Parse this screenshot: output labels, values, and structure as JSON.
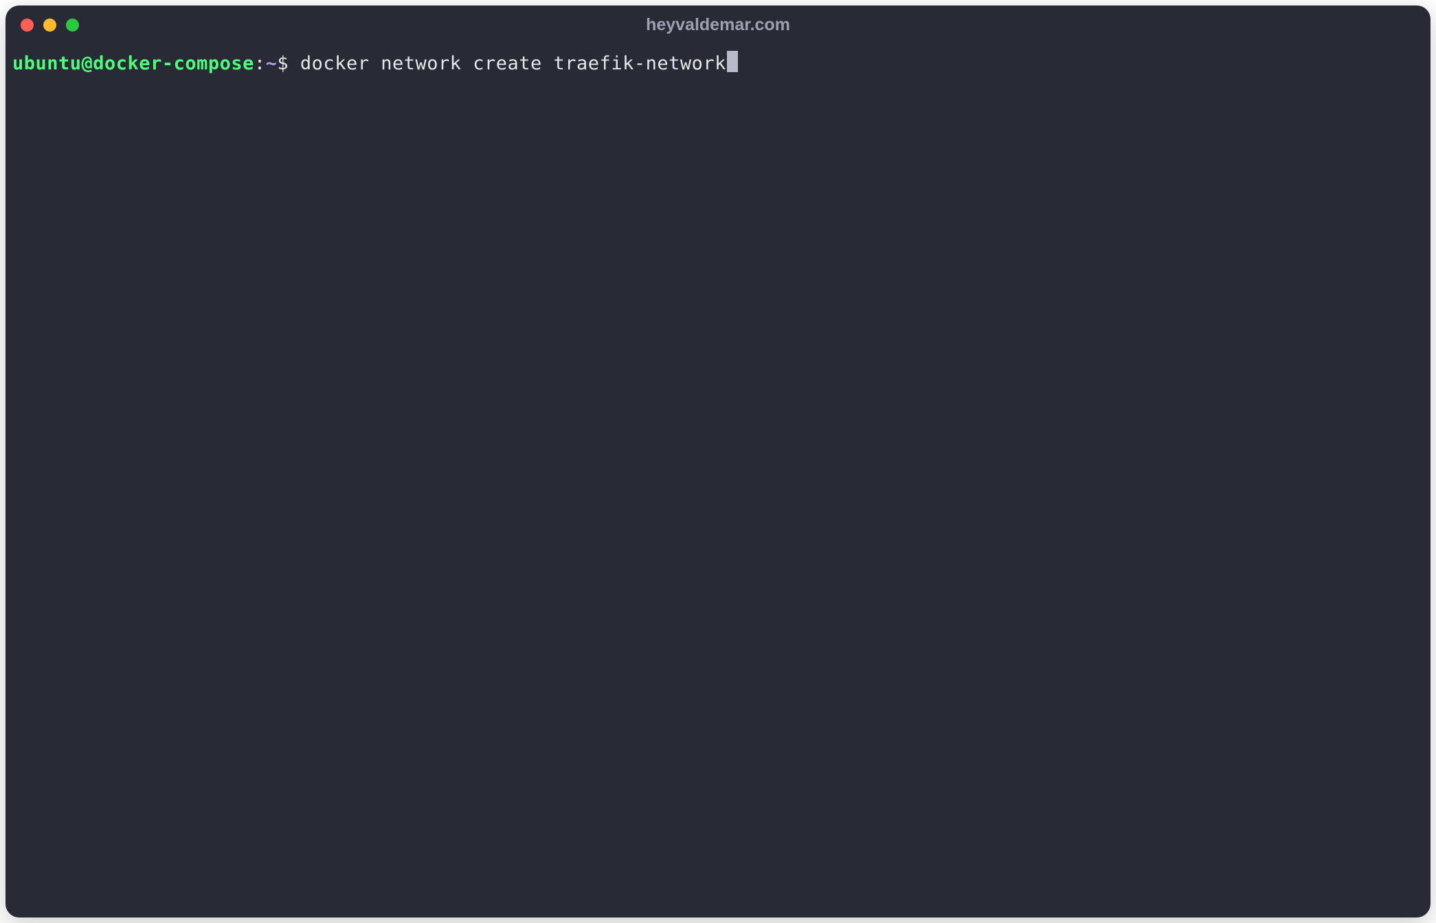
{
  "window": {
    "title": "heyvaldemar.com"
  },
  "prompt": {
    "user_host": "ubuntu@docker-compose",
    "separator_colon": ":",
    "path": "~",
    "dollar": "$ "
  },
  "terminal": {
    "command": "docker network create traefik-network"
  },
  "colors": {
    "background": "#282a36",
    "prompt_green": "#50fa7b",
    "path_purple": "#bd93f9",
    "text": "#e6e6e6",
    "title_text": "#9ca0b0",
    "traffic_red": "#ff5f57",
    "traffic_yellow": "#febc2e",
    "traffic_green": "#28c840"
  }
}
